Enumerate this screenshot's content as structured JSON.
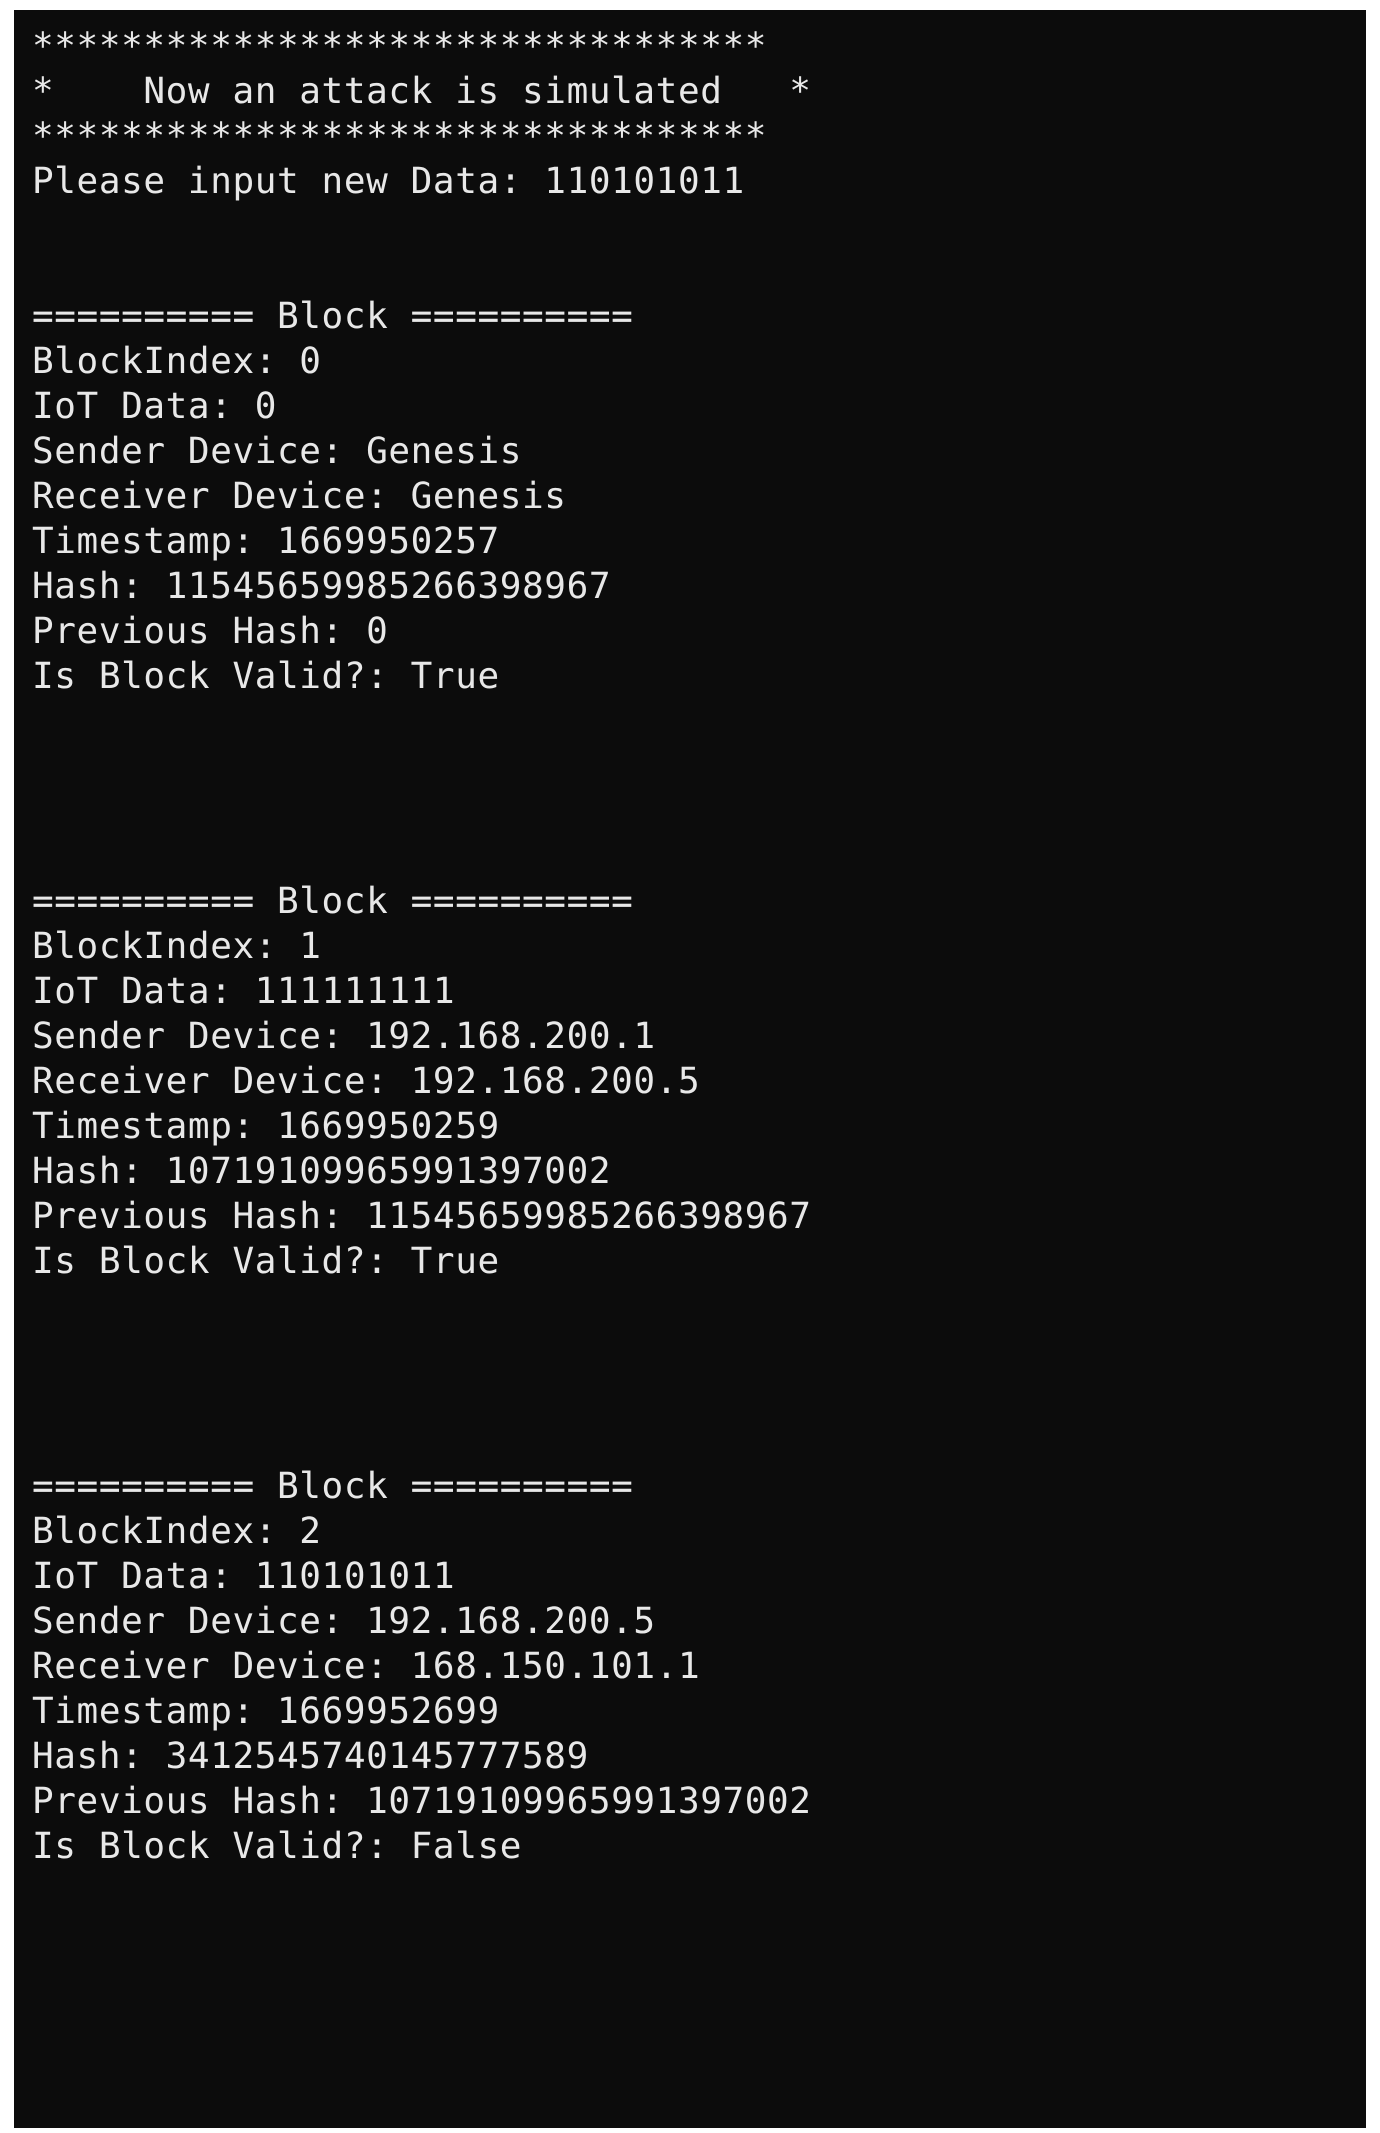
{
  "window": {
    "kind": "terminal-console",
    "background_color": "#0c0c0c",
    "text_color": "#e8e8e8",
    "frame_color": "#ffffff"
  },
  "banner": {
    "rule_top": "*********************************",
    "title_line": "*    Now an attack is simulated   *",
    "rule_bottom": "*********************************",
    "title_text": "Now an attack is simulated"
  },
  "prompt": {
    "label": "Please input new Data:",
    "value": "110101011",
    "full_line": "Please input new Data: 110101011"
  },
  "block_separator": "========== Block ==========",
  "field_labels": {
    "index": "BlockIndex:",
    "data": "IoT Data:",
    "sender": "Sender Device:",
    "receiver": "Receiver Device:",
    "timestamp": "Timestamp:",
    "hash": "Hash:",
    "previous_hash": "Previous Hash:",
    "valid": "Is Block Valid?:"
  },
  "blocks": [
    {
      "separator": "========== Block ==========",
      "index": "0",
      "data": "0",
      "sender": "Genesis",
      "receiver": "Genesis",
      "timestamp": "1669950257",
      "hash": "11545659985266398967",
      "previous_hash": "0",
      "valid": "True",
      "lines": [
        "========== Block ==========",
        "BlockIndex: 0",
        "IoT Data: 0",
        "Sender Device: Genesis",
        "Receiver Device: Genesis",
        "Timestamp: 1669950257",
        "Hash: 11545659985266398967",
        "Previous Hash: 0",
        "Is Block Valid?: True"
      ]
    },
    {
      "separator": "========== Block ==========",
      "index": "1",
      "data": "111111111",
      "sender": "192.168.200.1",
      "receiver": "192.168.200.5",
      "timestamp": "1669950259",
      "hash": "10719109965991397002",
      "previous_hash": "11545659985266398967",
      "valid": "True",
      "lines": [
        "========== Block ==========",
        "BlockIndex: 1",
        "IoT Data: 111111111",
        "Sender Device: 192.168.200.1",
        "Receiver Device: 192.168.200.5",
        "Timestamp: 1669950259",
        "Hash: 10719109965991397002",
        "Previous Hash: 11545659985266398967",
        "Is Block Valid?: True"
      ]
    },
    {
      "separator": "========== Block ==========",
      "index": "2",
      "data": "110101011",
      "sender": "192.168.200.5",
      "receiver": "168.150.101.1",
      "timestamp": "1669952699",
      "hash": "3412545740145777589",
      "previous_hash": "10719109965991397002",
      "valid": "False",
      "lines": [
        "========== Block ==========",
        "BlockIndex: 2",
        "IoT Data: 110101011",
        "Sender Device: 192.168.200.5",
        "Receiver Device: 168.150.101.1",
        "Timestamp: 1669952699",
        "Hash: 3412545740145777589",
        "Previous Hash: 10719109965991397002",
        "Is Block Valid?: False"
      ]
    }
  ],
  "console_lines": [
    "*********************************",
    "*    Now an attack is simulated   *",
    "*********************************",
    "Please input new Data: 110101011",
    "",
    "",
    "========== Block ==========",
    "BlockIndex: 0",
    "IoT Data: 0",
    "Sender Device: Genesis",
    "Receiver Device: Genesis",
    "Timestamp: 1669950257",
    "Hash: 11545659985266398967",
    "Previous Hash: 0",
    "Is Block Valid?: True",
    "",
    "",
    "",
    "",
    "========== Block ==========",
    "BlockIndex: 1",
    "IoT Data: 111111111",
    "Sender Device: 192.168.200.1",
    "Receiver Device: 192.168.200.5",
    "Timestamp: 1669950259",
    "Hash: 10719109965991397002",
    "Previous Hash: 11545659985266398967",
    "Is Block Valid?: True",
    "",
    "",
    "",
    "",
    "========== Block ==========",
    "BlockIndex: 2",
    "IoT Data: 110101011",
    "Sender Device: 192.168.200.5",
    "Receiver Device: 168.150.101.1",
    "Timestamp: 1669952699",
    "Hash: 3412545740145777589",
    "Previous Hash: 10719109965991397002",
    "Is Block Valid?: False"
  ]
}
